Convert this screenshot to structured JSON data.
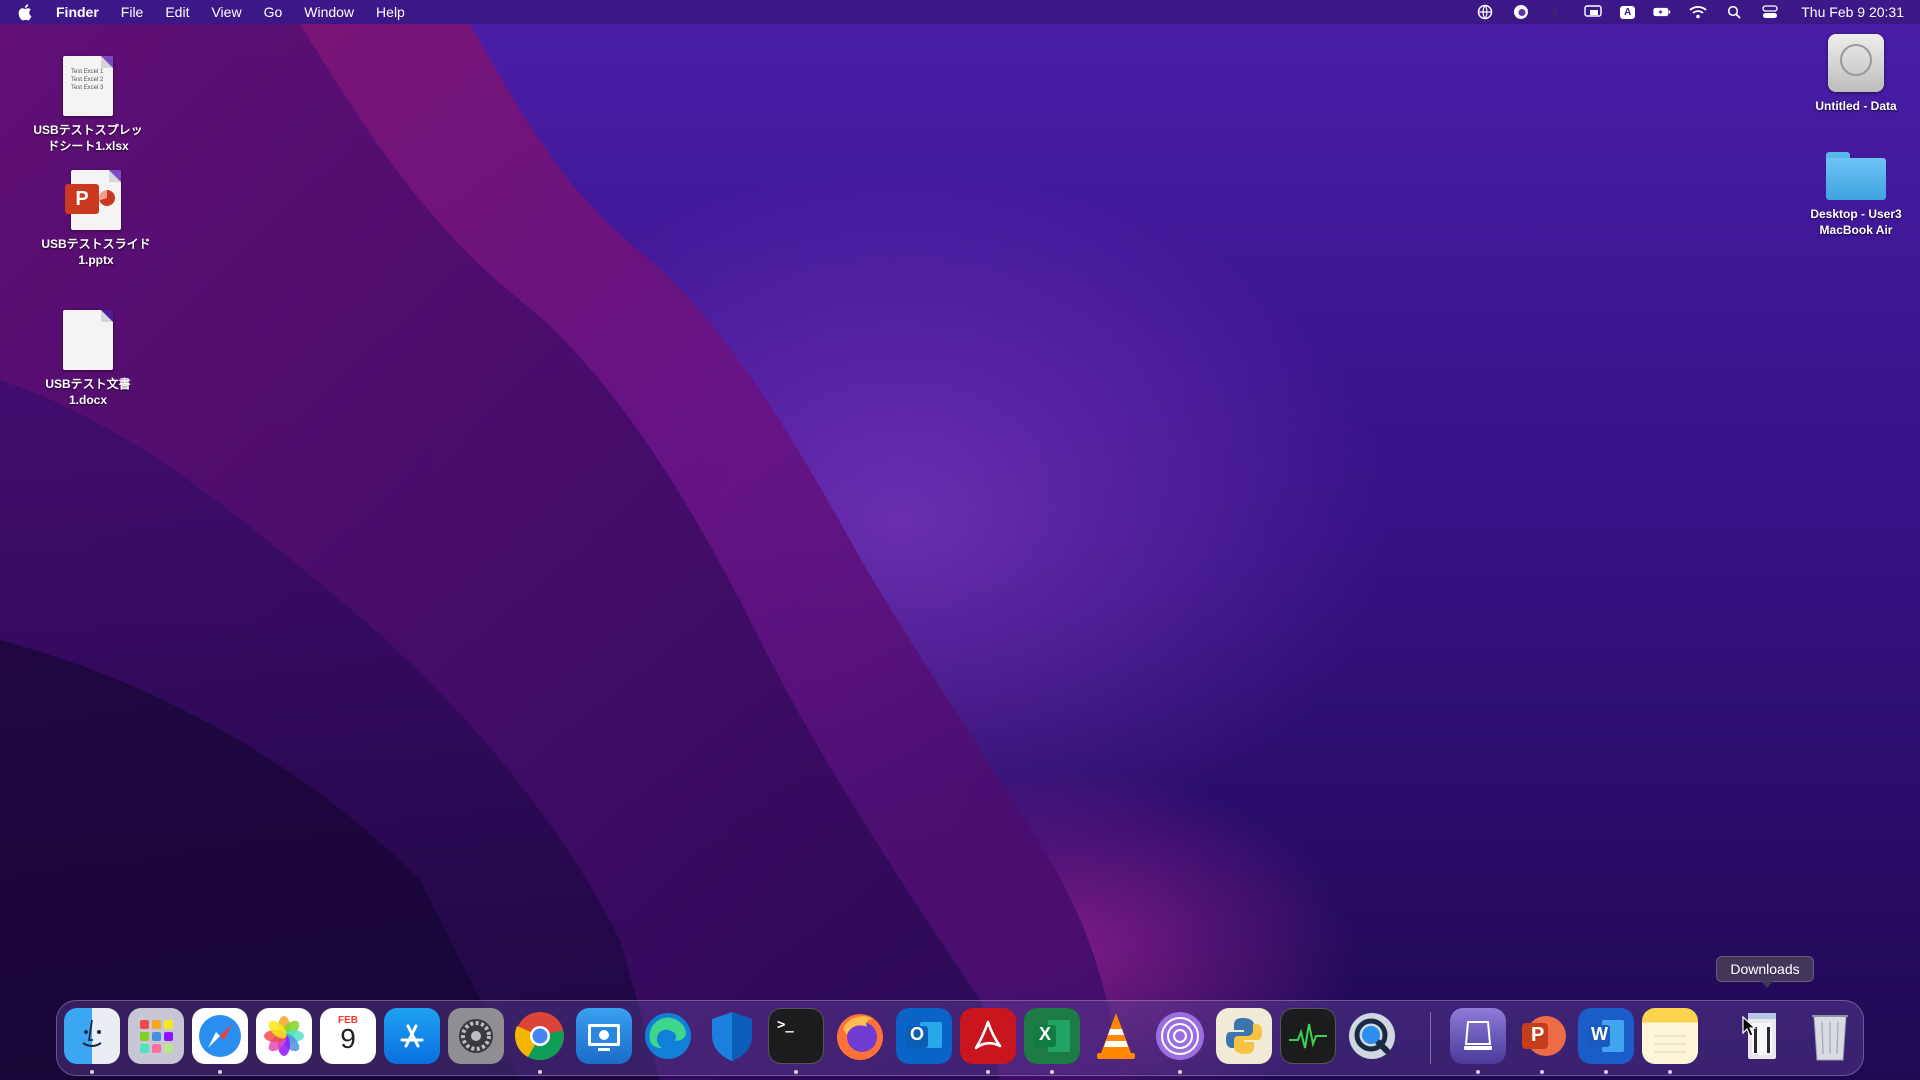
{
  "menubar": {
    "apple_icon": "apple-logo-icon",
    "app_name": "Finder",
    "menus": [
      "File",
      "Edit",
      "View",
      "Go",
      "Window",
      "Help"
    ],
    "status_icons": [
      "globe-sync-icon",
      "edge-icon",
      "moon-icon",
      "screen-mirroring-icon",
      "input-source-icon",
      "battery-charging-icon",
      "wifi-icon",
      "spotlight-search-icon",
      "control-center-icon"
    ],
    "input_source_letter": "A",
    "clock": "Thu Feb 9  20:31"
  },
  "desktop_icons_left": [
    {
      "label": "USBテストスプレッ\nドシート1.xlsx",
      "icon": "xlsx-file-icon",
      "preview_lines": [
        "Test Excel 1",
        "Test Excel 2",
        "Test Excel 3"
      ]
    },
    {
      "label": "USBテストスライド\n1.pptx",
      "icon": "pptx-file-icon",
      "badge": "P"
    },
    {
      "label": "USBテスト文書\n1.docx",
      "icon": "docx-file-icon"
    }
  ],
  "desktop_icons_right": [
    {
      "label": "Untitled - Data",
      "icon": "hard-drive-icon"
    },
    {
      "label": "Desktop - User3\nMacBook Air",
      "icon": "folder-icon"
    }
  ],
  "dock": {
    "apps": [
      {
        "name": "Finder",
        "icon": "finder-icon",
        "running": true
      },
      {
        "name": "Launchpad",
        "icon": "launchpad-icon",
        "running": false
      },
      {
        "name": "Safari",
        "icon": "safari-icon",
        "running": true
      },
      {
        "name": "Photos",
        "icon": "photos-icon",
        "running": false
      },
      {
        "name": "Calendar",
        "icon": "calendar-icon",
        "running": false,
        "month": "FEB",
        "day": "9"
      },
      {
        "name": "App Store",
        "icon": "app-store-icon",
        "running": false
      },
      {
        "name": "System Preferences",
        "icon": "system-preferences-icon",
        "running": false
      },
      {
        "name": "Google Chrome",
        "icon": "chrome-icon",
        "running": true
      },
      {
        "name": "Remote Desktop",
        "icon": "remote-desktop-icon",
        "running": false
      },
      {
        "name": "Microsoft Edge",
        "icon": "edge-icon",
        "running": false
      },
      {
        "name": "Microsoft Defender",
        "icon": "defender-shield-icon",
        "running": false
      },
      {
        "name": "Terminal",
        "icon": "terminal-icon",
        "running": true
      },
      {
        "name": "Firefox",
        "icon": "firefox-icon",
        "running": false
      },
      {
        "name": "Microsoft Outlook",
        "icon": "outlook-icon",
        "running": false,
        "letter": "O"
      },
      {
        "name": "Adobe Acrobat Reader",
        "icon": "acrobat-icon",
        "running": true
      },
      {
        "name": "Microsoft Excel",
        "icon": "excel-icon",
        "running": true,
        "letter": "X"
      },
      {
        "name": "VLC",
        "icon": "vlc-cone-icon",
        "running": false
      },
      {
        "name": "Tor Browser",
        "icon": "tor-browser-icon",
        "running": true
      },
      {
        "name": "Python",
        "icon": "python-icon",
        "running": false
      },
      {
        "name": "Activity Monitor",
        "icon": "activity-monitor-icon",
        "running": false
      },
      {
        "name": "QuickTime Player",
        "icon": "quicktime-icon",
        "running": false
      },
      {
        "name": "Simulator",
        "icon": "simulator-icon",
        "running": true
      },
      {
        "name": "Microsoft PowerPoint",
        "icon": "powerpoint-icon",
        "running": true,
        "letter": "P"
      },
      {
        "name": "Microsoft Word",
        "icon": "word-icon",
        "running": true,
        "letter": "W"
      },
      {
        "name": "Notes",
        "icon": "notes-icon",
        "running": true
      },
      {
        "name": "Downloads",
        "icon": "downloads-stack-icon",
        "running": false
      },
      {
        "name": "Trash",
        "icon": "trash-icon",
        "running": false
      }
    ],
    "tooltip": "Downloads"
  },
  "colors": {
    "wallpaper_top": "#4a1ea8",
    "wallpaper_bottom": "#1f0a52",
    "wallpaper_accent": "#c0289c"
  }
}
